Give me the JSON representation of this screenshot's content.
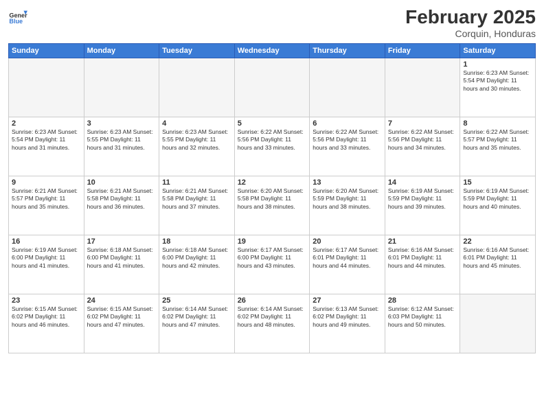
{
  "logo": {
    "general": "General",
    "blue": "Blue"
  },
  "title": "February 2025",
  "subtitle": "Corquin, Honduras",
  "weekdays": [
    "Sunday",
    "Monday",
    "Tuesday",
    "Wednesday",
    "Thursday",
    "Friday",
    "Saturday"
  ],
  "weeks": [
    [
      {
        "day": "",
        "info": ""
      },
      {
        "day": "",
        "info": ""
      },
      {
        "day": "",
        "info": ""
      },
      {
        "day": "",
        "info": ""
      },
      {
        "day": "",
        "info": ""
      },
      {
        "day": "",
        "info": ""
      },
      {
        "day": "1",
        "info": "Sunrise: 6:23 AM\nSunset: 5:54 PM\nDaylight: 11 hours and 30 minutes."
      }
    ],
    [
      {
        "day": "2",
        "info": "Sunrise: 6:23 AM\nSunset: 5:54 PM\nDaylight: 11 hours and 31 minutes."
      },
      {
        "day": "3",
        "info": "Sunrise: 6:23 AM\nSunset: 5:55 PM\nDaylight: 11 hours and 31 minutes."
      },
      {
        "day": "4",
        "info": "Sunrise: 6:23 AM\nSunset: 5:55 PM\nDaylight: 11 hours and 32 minutes."
      },
      {
        "day": "5",
        "info": "Sunrise: 6:22 AM\nSunset: 5:56 PM\nDaylight: 11 hours and 33 minutes."
      },
      {
        "day": "6",
        "info": "Sunrise: 6:22 AM\nSunset: 5:56 PM\nDaylight: 11 hours and 33 minutes."
      },
      {
        "day": "7",
        "info": "Sunrise: 6:22 AM\nSunset: 5:56 PM\nDaylight: 11 hours and 34 minutes."
      },
      {
        "day": "8",
        "info": "Sunrise: 6:22 AM\nSunset: 5:57 PM\nDaylight: 11 hours and 35 minutes."
      }
    ],
    [
      {
        "day": "9",
        "info": "Sunrise: 6:21 AM\nSunset: 5:57 PM\nDaylight: 11 hours and 35 minutes."
      },
      {
        "day": "10",
        "info": "Sunrise: 6:21 AM\nSunset: 5:58 PM\nDaylight: 11 hours and 36 minutes."
      },
      {
        "day": "11",
        "info": "Sunrise: 6:21 AM\nSunset: 5:58 PM\nDaylight: 11 hours and 37 minutes."
      },
      {
        "day": "12",
        "info": "Sunrise: 6:20 AM\nSunset: 5:58 PM\nDaylight: 11 hours and 38 minutes."
      },
      {
        "day": "13",
        "info": "Sunrise: 6:20 AM\nSunset: 5:59 PM\nDaylight: 11 hours and 38 minutes."
      },
      {
        "day": "14",
        "info": "Sunrise: 6:19 AM\nSunset: 5:59 PM\nDaylight: 11 hours and 39 minutes."
      },
      {
        "day": "15",
        "info": "Sunrise: 6:19 AM\nSunset: 5:59 PM\nDaylight: 11 hours and 40 minutes."
      }
    ],
    [
      {
        "day": "16",
        "info": "Sunrise: 6:19 AM\nSunset: 6:00 PM\nDaylight: 11 hours and 41 minutes."
      },
      {
        "day": "17",
        "info": "Sunrise: 6:18 AM\nSunset: 6:00 PM\nDaylight: 11 hours and 41 minutes."
      },
      {
        "day": "18",
        "info": "Sunrise: 6:18 AM\nSunset: 6:00 PM\nDaylight: 11 hours and 42 minutes."
      },
      {
        "day": "19",
        "info": "Sunrise: 6:17 AM\nSunset: 6:00 PM\nDaylight: 11 hours and 43 minutes."
      },
      {
        "day": "20",
        "info": "Sunrise: 6:17 AM\nSunset: 6:01 PM\nDaylight: 11 hours and 44 minutes."
      },
      {
        "day": "21",
        "info": "Sunrise: 6:16 AM\nSunset: 6:01 PM\nDaylight: 11 hours and 44 minutes."
      },
      {
        "day": "22",
        "info": "Sunrise: 6:16 AM\nSunset: 6:01 PM\nDaylight: 11 hours and 45 minutes."
      }
    ],
    [
      {
        "day": "23",
        "info": "Sunrise: 6:15 AM\nSunset: 6:02 PM\nDaylight: 11 hours and 46 minutes."
      },
      {
        "day": "24",
        "info": "Sunrise: 6:15 AM\nSunset: 6:02 PM\nDaylight: 11 hours and 47 minutes."
      },
      {
        "day": "25",
        "info": "Sunrise: 6:14 AM\nSunset: 6:02 PM\nDaylight: 11 hours and 47 minutes."
      },
      {
        "day": "26",
        "info": "Sunrise: 6:14 AM\nSunset: 6:02 PM\nDaylight: 11 hours and 48 minutes."
      },
      {
        "day": "27",
        "info": "Sunrise: 6:13 AM\nSunset: 6:02 PM\nDaylight: 11 hours and 49 minutes."
      },
      {
        "day": "28",
        "info": "Sunrise: 6:12 AM\nSunset: 6:03 PM\nDaylight: 11 hours and 50 minutes."
      },
      {
        "day": "",
        "info": ""
      }
    ]
  ]
}
